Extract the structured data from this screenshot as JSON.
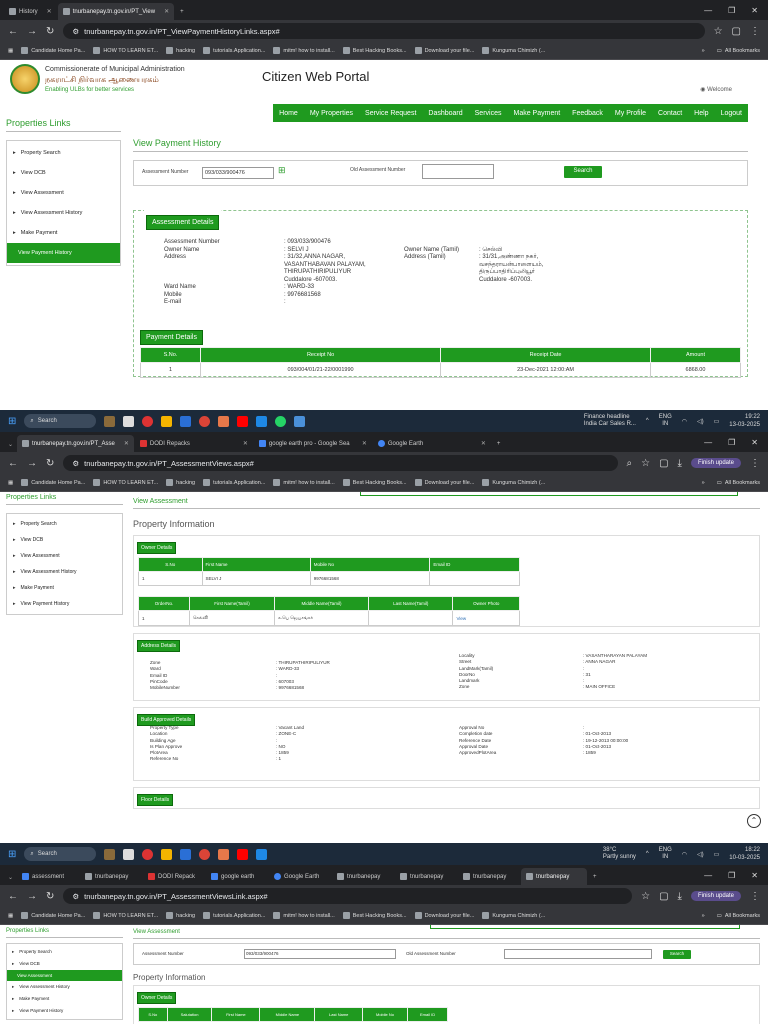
{
  "s1": {
    "tabs": [
      {
        "label": "History",
        "active": false
      },
      {
        "label": "tnurbanepay.tn.gov.in/PT_View",
        "active": true
      }
    ],
    "url": "tnurbanepay.tn.gov.in/PT_ViewPaymentHistoryLinks.aspx#",
    "bookmarks": [
      "Candidate Home Pa...",
      "HOW TO LEARN ET...",
      "hacking",
      "tutorials.Application...",
      "mitm! how to install...",
      "Best Hacking Books...",
      "Download your file...",
      "Kunguma Chimizh (..."
    ],
    "all_bookmarks": "All Bookmarks",
    "site": {
      "org": "Commissionerate of Municipal Administration",
      "org_ta": "நகராட்சி நிர்வாக ஆணையரகம்",
      "tagline": "Enabling ULBs for better services",
      "portal": "Citizen Web Portal",
      "welcome": "Welcome",
      "nav": [
        "Home",
        "My Properties",
        "Service Request",
        "Dashboard",
        "Services",
        "Make Payment",
        "Feedback",
        "My Profile",
        "Contact",
        "Help",
        "Logout"
      ]
    },
    "left_title": "Properties Links",
    "links": [
      "Property Search",
      "View DCB",
      "View Assessment",
      "View Assessment History",
      "Make Payment",
      "View Payment History"
    ],
    "title": "View Payment History",
    "search": {
      "label": "Assessment Number",
      "value": "093/033/900476",
      "old_label": "Old Assessment Number",
      "old_value": "",
      "button": "Search"
    },
    "assessment": {
      "header": "Assessment Details",
      "assessment_no_label": "Assessment Number",
      "assessment_no": ": 093/033/900476",
      "owner_label": "Owner Name",
      "owner": ": SELVI J",
      "owner_ta_label": "Owner Name (Tamil)",
      "owner_ta": ": செல்வி",
      "address_label": "Address",
      "address": [
        ": 31/32,ANNA NAGAR,",
        "VASANTHABAVAN PALAYAM,",
        "THIRUPATHIRIPULIYUR",
        "Cuddalore -607003."
      ],
      "address_ta_label": "Address (Tamil)",
      "address_ta": [
        ": 31/31,அண்ணா நகர்,",
        "வசந்தராயன்பாளையம்,",
        "திருப்பாதிரிப்புலியூர்",
        "Cuddalore -607003."
      ],
      "ward_label": "Ward Name",
      "ward": ": WARD-33",
      "mobile_label": "Mobile",
      "mobile": ": 9976681568",
      "email_label": "E-mail",
      "email": ":"
    },
    "payment": {
      "header": "Payment Details",
      "columns": [
        "S.No.",
        "Receipt No",
        "Receipt Date",
        "Amount"
      ],
      "rows": [
        [
          "1",
          "093/004/01/21-22/0001990",
          "23-Dec-2021 12:00:AM",
          "6868.00"
        ]
      ]
    },
    "taskbar": {
      "search": "Search",
      "news": "Finance headline",
      "news2": "India Car Sales R...",
      "lang": "ENG",
      "lang2": "IN",
      "time": "19:22",
      "date": "13-03-2025"
    }
  },
  "s2": {
    "tabs": [
      {
        "label": "tnurbanepay.tn.gov.in/PT_Asse",
        "active": true
      },
      {
        "label": "DODI Repacks",
        "active": false
      },
      {
        "label": "google earth pro - Google Sea",
        "active": false
      },
      {
        "label": "Google Earth",
        "active": false
      }
    ],
    "url": "tnurbanepay.tn.gov.in/PT_AssessmentViews.aspx#",
    "finish_update": "Finish update",
    "left_title": "Properties Links",
    "links": [
      "Property Search",
      "View DCB",
      "View Assessment",
      "View Assessment History",
      "Make Payment",
      "View Payment History"
    ],
    "view_assessment": "View Assessment",
    "title": "Property Information",
    "owner_header": "Owner Details",
    "owner_cols": [
      "S.No",
      "First Name",
      "Mobile No",
      "Email ID"
    ],
    "owner_row": [
      "1",
      "SELVI J",
      "9976681568",
      ""
    ],
    "owner_ta_cols": [
      "OrderNo.",
      "First Name(Tamil)",
      "Middle Name(Tamil)",
      "Last Name(Tamil)",
      "Owner Photo"
    ],
    "owner_ta_row": [
      "1",
      "செல்வி",
      "க.பெ ஜெயசங்கர்",
      "",
      "View"
    ],
    "address_header": "Address Details",
    "address_left": [
      [
        "Zone",
        ": THIRUPATHIRIPULIYUR"
      ],
      [
        "Ward",
        ": WARD-33"
      ],
      [
        "Email ID",
        ":"
      ],
      [
        "PinCode",
        ": 607003"
      ],
      [
        "MobileNumber",
        ": 9976681568"
      ]
    ],
    "address_right": [
      [
        "Locality",
        ": VASANTHARAYAN PALAYAM"
      ],
      [
        "Street",
        ": ANNA NAGAR"
      ],
      [
        "LandMark(Tamil)",
        ":"
      ],
      [
        "DoorNo",
        ": 31"
      ],
      [
        "Landmark",
        ":"
      ],
      [
        "Zone",
        ": MAIN OFFICE"
      ]
    ],
    "build_header": "Build Approved Details",
    "build_left": [
      [
        "Property Type",
        ": Vacant Land"
      ],
      [
        "Location",
        ": ZONE-C"
      ],
      [
        "Building Age",
        ":"
      ],
      [
        "Is Plan Approve",
        ": NO"
      ],
      [
        "PlotArea",
        ": 1859"
      ],
      [
        "Reference No",
        ": 1"
      ]
    ],
    "build_right": [
      [
        "Approval No",
        ":"
      ],
      [
        "Completion date",
        ": 01-Oct-2013"
      ],
      [
        "Reference Date",
        ": 19-12-2013 00:00:00"
      ],
      [
        "Approval Date",
        ": 01-Oct-2013"
      ],
      [
        "ApprovedPlotArea",
        ": 1859"
      ]
    ],
    "floor_header": "Floor Details",
    "taskbar": {
      "search": "Search",
      "weather": "38°C",
      "weather2": "Partly sunny",
      "lang": "ENG",
      "lang2": "IN",
      "time": "18:22",
      "date": "10-03-2025"
    }
  },
  "s3": {
    "tabs": [
      {
        "label": "assessment",
        "active": false
      },
      {
        "label": "tnurbanepay",
        "active": false
      },
      {
        "label": "DODI Repack",
        "active": false
      },
      {
        "label": "google earth",
        "active": false
      },
      {
        "label": "Google Earth",
        "active": false
      },
      {
        "label": "tnurbanepay",
        "active": false
      },
      {
        "label": "tnurbanepay",
        "active": false
      },
      {
        "label": "tnurbanepay",
        "active": false
      },
      {
        "label": "tnurbanepay",
        "active": true
      }
    ],
    "url": "tnurbanepay.tn.gov.in/PT_AssessmentViewsLink.aspx#",
    "finish_update": "Finish update",
    "left_title": "Properties Links",
    "links": [
      "Property Search",
      "View DCB",
      "View Assessment",
      "View Assessment History",
      "Make Payment",
      "View Payment History"
    ],
    "view_assessment": "View Assessment",
    "search": {
      "label": "Assessment Number",
      "value": "093/033/900476",
      "old_label": "Old Assessment Number",
      "button": "Search"
    },
    "title": "Property Information",
    "owner_header": "Owner Details",
    "owner_cols": [
      "S.No",
      "Salutation",
      "First Name",
      "Middle Name",
      "Last Name",
      "Mobile No",
      "Email ID"
    ]
  }
}
